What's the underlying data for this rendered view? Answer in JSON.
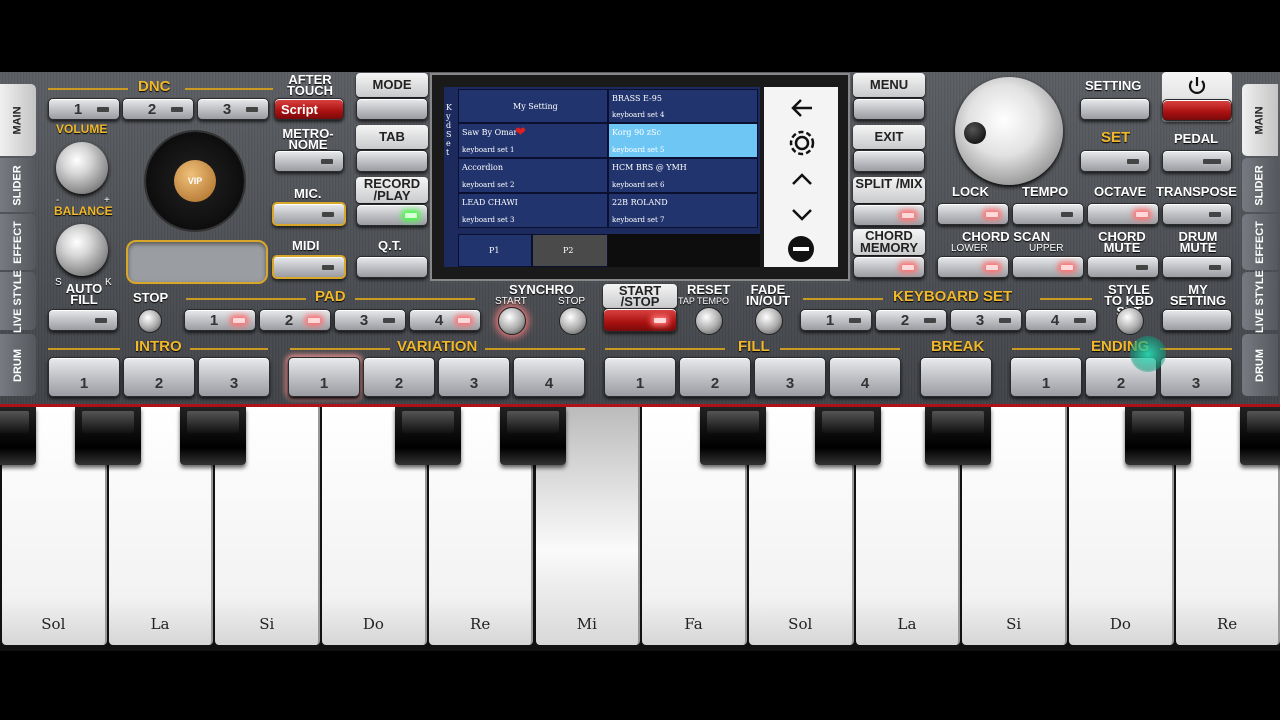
{
  "tabs_left": [
    {
      "label": "MAIN",
      "active": true
    },
    {
      "label": "SLIDER",
      "active": false
    },
    {
      "label": "EFFECT",
      "active": false
    },
    {
      "label": "LIVE STYLE",
      "active": false
    },
    {
      "label": "DRUM",
      "active": false
    }
  ],
  "tabs_right": [
    {
      "label": "MAIN",
      "active": true
    },
    {
      "label": "SLIDER",
      "active": false
    },
    {
      "label": "EFFECT",
      "active": false
    },
    {
      "label": "LIVE STYLE",
      "active": false
    },
    {
      "label": "DRUM",
      "active": false
    }
  ],
  "dnc": {
    "label": "DNC",
    "buttons": [
      "1",
      "2",
      "3"
    ]
  },
  "after_touch": {
    "label": "AFTER TOUCH",
    "value": "Script"
  },
  "volume": {
    "label": "VOLUME",
    "min": "-",
    "max": "+"
  },
  "balance": {
    "label": "BALANCE",
    "left": "S",
    "right": "K"
  },
  "vip_label": "VIP",
  "metronome": {
    "label": "METRO- NOME"
  },
  "mic": {
    "label": "MIC."
  },
  "midi": {
    "label": "MIDI"
  },
  "center_buttons": {
    "mode": "MODE",
    "tab": "TAB",
    "record": "RECORD /PLAY",
    "qt": "Q.T."
  },
  "screen": {
    "side_letters": "K y d S e t",
    "cells": [
      {
        "title": "My Setting",
        "sub": ""
      },
      {
        "title": "BRASS E-95",
        "sub": "keyboard set 4"
      },
      {
        "title": "Saw By Omar",
        "sub": "keyboard set 1"
      },
      {
        "title": "Korg 90 zSc",
        "sub": "keyboard set 5"
      },
      {
        "title": "Accordion",
        "sub": "keyboard set 2"
      },
      {
        "title": "HCM BRS @ YMH",
        "sub": "keyboard set 6"
      },
      {
        "title": "LEAD CHAWI",
        "sub": "keyboard set 3"
      },
      {
        "title": "22B ROLAND",
        "sub": "keyboard set 7"
      }
    ],
    "pages": [
      "P1",
      "P2"
    ],
    "nav_icons": [
      "back-arrow-icon",
      "gear-icon",
      "chevron-up-icon",
      "chevron-down-icon",
      "minus-circle-icon"
    ]
  },
  "right_center": {
    "menu": "MENU",
    "exit": "EXIT",
    "split": "SPLIT /MIX",
    "chord_memory": "CHORD MEMORY"
  },
  "setting": {
    "label": "SETTING",
    "set_label": "SET",
    "pedal_label": "PEDAL",
    "power_icon": "power-icon"
  },
  "row_labels": {
    "lock": "LOCK",
    "tempo": "TEMPO",
    "octave": "OCTAVE",
    "transpose": "TRANSPOSE",
    "chord_scan": "CHORD SCAN",
    "lower": "LOWER",
    "upper": "UPPER",
    "chord_mute": "CHORD MUTE",
    "drum_mute": "DRUM MUTE"
  },
  "pad": {
    "label": "PAD",
    "stop_label": "STOP",
    "auto_fill": "AUTO FILL",
    "buttons": [
      "1",
      "2",
      "3",
      "4"
    ]
  },
  "synchro": {
    "label": "SYNCHRO",
    "start": "START",
    "stop": "STOP"
  },
  "start_stop": "START /STOP",
  "reset": {
    "label": "RESET",
    "sub": "TAP TEMPO"
  },
  "fade": "FADE IN/OUT",
  "keyboard_set": {
    "label": "KEYBOARD SET",
    "buttons": [
      "1",
      "2",
      "3",
      "4"
    ]
  },
  "style_to_kbd": "STYLE TO KBD SET",
  "my_setting": "MY SETTING",
  "intro": {
    "label": "INTRO",
    "buttons": [
      "1",
      "2",
      "3"
    ]
  },
  "variation": {
    "label": "VARIATION",
    "buttons": [
      "1",
      "2",
      "3",
      "4"
    ]
  },
  "fill": {
    "label": "FILL",
    "buttons": [
      "1",
      "2",
      "3",
      "4"
    ]
  },
  "break_label": "BREAK",
  "ending": {
    "label": "ENDING",
    "buttons": [
      "1",
      "2",
      "3"
    ]
  },
  "keys": {
    "white": [
      "Sol",
      "La",
      "Si",
      "Do",
      "Re",
      "Mi",
      "Fa",
      "Sol",
      "La",
      "Si",
      "Do",
      "Re"
    ],
    "pressed_index": 5
  }
}
